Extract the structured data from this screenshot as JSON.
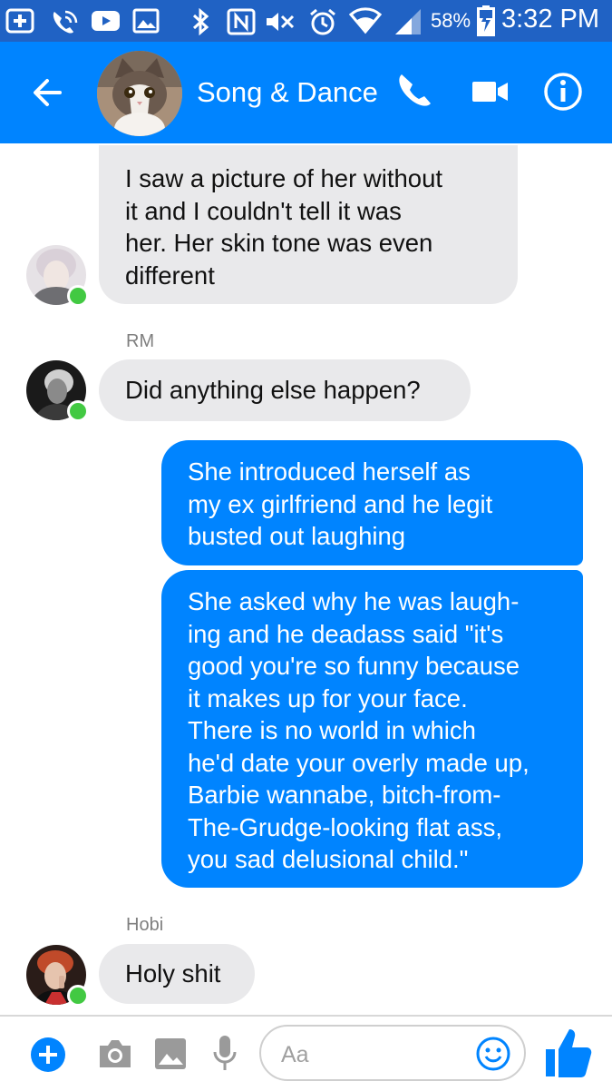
{
  "status_bar": {
    "battery_percent": "58%",
    "time": "3:32 PM",
    "icons": [
      "add-icon",
      "wifi-call-icon",
      "youtube-icon",
      "image-icon",
      "bluetooth-icon",
      "nfc-icon",
      "mute-icon",
      "alarm-icon",
      "wifi-icon",
      "signal-icon",
      "battery-charging-icon"
    ]
  },
  "header": {
    "title": "Song & Dance",
    "icons": [
      "back-arrow-icon",
      "phone-icon",
      "video-camera-icon",
      "info-icon"
    ]
  },
  "messages": [
    {
      "side": "in",
      "lines": [
        "I saw a picture of her without",
        "it and I couldn't tell it was",
        "her. Her skin tone was even",
        "different"
      ]
    },
    {
      "side": "in",
      "sender": "RM",
      "lines": [
        "Did anything else happen?"
      ]
    },
    {
      "side": "out",
      "lines": [
        "She introduced herself as",
        "my ex girlfriend and he legit",
        "busted out laughing"
      ]
    },
    {
      "side": "out",
      "lines": [
        "She asked why he was laugh-",
        "ing and he deadass said \"it's",
        "good you're so funny because",
        "it makes up for your face.",
        "There is no world in which",
        "he'd date your overly made up,",
        "Barbie wannabe, bitch-from-",
        "The-Grudge-looking flat ass,",
        "you sad delusional child.\""
      ]
    },
    {
      "side": "in",
      "sender": "Hobi",
      "lines": [
        "Holy shit"
      ]
    }
  ],
  "composer": {
    "placeholder": "Aa",
    "icons": [
      "add-circle-icon",
      "camera-icon",
      "gallery-icon",
      "microphone-icon",
      "emoji-icon",
      "thumbs-up-icon"
    ]
  },
  "colors": {
    "accent": "#0084ff",
    "status_bar": "#2062c4",
    "incoming_bubble": "#e9e9eb",
    "online": "#42c942"
  }
}
